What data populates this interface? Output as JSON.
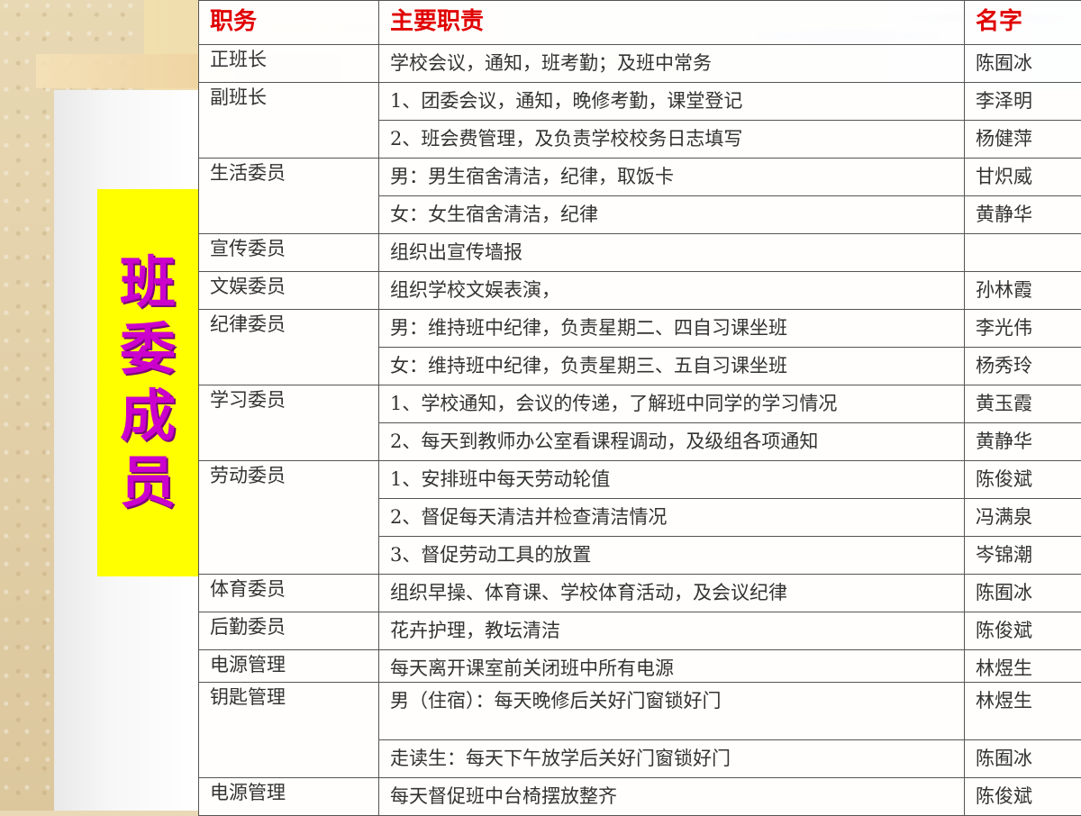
{
  "title_chars": [
    "班",
    "委",
    "成",
    "员"
  ],
  "headers": {
    "role": "职务",
    "duty": "主要职责",
    "name": "名字"
  },
  "rows": [
    {
      "role": "正班长",
      "duty": "学校会议，通知，班考勤；及班中常务",
      "name": "陈囿冰"
    },
    {
      "role": "副班长",
      "duty": "1、团委会议，通知，晚修考勤，课堂登记",
      "name": "李泽明"
    },
    {
      "role": "",
      "duty": "2、班会费管理，及负责学校校务日志填写",
      "name": "杨健萍"
    },
    {
      "role": "生活委员",
      "duty": "男：男生宿舍清洁，纪律，取饭卡",
      "name": "甘炽威"
    },
    {
      "role": "",
      "duty": "女：女生宿舍清洁，纪律",
      "name": "黄静华"
    },
    {
      "role": "宣传委员",
      "duty": "组织出宣传墙报",
      "name": ""
    },
    {
      "role": "文娱委员",
      "duty": "组织学校文娱表演，",
      "name": "孙林霞"
    },
    {
      "role": "纪律委员",
      "duty": "男：维持班中纪律，负责星期二、四自习课坐班",
      "name": "李光伟"
    },
    {
      "role": "",
      "duty": "女：维持班中纪律，负责星期三、五自习课坐班",
      "name": "杨秀玲"
    },
    {
      "role": "学习委员",
      "duty": "1、学校通知，会议的传递，了解班中同学的学习情况",
      "name": "黄玉霞"
    },
    {
      "role": "",
      "duty": "2、每天到教师办公室看课程调动，及级组各项通知",
      "name": "黄静华"
    },
    {
      "role": "劳动委员",
      "duty": "1、安排班中每天劳动轮值",
      "name": "陈俊斌"
    },
    {
      "role": "",
      "duty": "2、督促每天清洁并检查清洁情况",
      "name": "冯满泉"
    },
    {
      "role": "",
      "duty": "3、督促劳动工具的放置",
      "name": "岑锦潮"
    },
    {
      "role": "体育委员",
      "duty": "组织早操、体育课、学校体育活动，及会议纪律",
      "name": "陈囿冰"
    },
    {
      "role": "后勤委员",
      "duty": "花卉护理，教坛清洁",
      "name": "陈俊斌"
    },
    {
      "role": "电源管理",
      "duty": "每天离开课室前关闭班中所有电源",
      "name": "林煜生"
    },
    {
      "role": "钥匙管理",
      "duty": "男（住宿）：每天晚修后关好门窗锁好门",
      "name": "林煜生"
    },
    {
      "role": "",
      "duty": "走读生：每天下午放学后关好门窗锁好门",
      "name": "陈囿冰"
    },
    {
      "role": "电源管理",
      "duty": "每天督促班中台椅摆放整齐",
      "name": "陈俊斌"
    }
  ]
}
